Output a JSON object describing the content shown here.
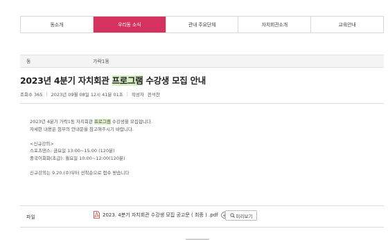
{
  "tabs": [
    {
      "label": "동소개",
      "active": false
    },
    {
      "label": "우리동 소식",
      "active": true
    },
    {
      "label": "관내 주요단체",
      "active": false
    },
    {
      "label": "자치회관소개",
      "active": false
    },
    {
      "label": "교육안내",
      "active": false
    }
  ],
  "info": {
    "label": "동",
    "value": "가락1동"
  },
  "post": {
    "title_before": "2023년 4분기 자치회관 ",
    "title_highlight": "프로그램",
    "title_after": " 수강생 모집 안내",
    "views": "조회수 365",
    "date": "2023년 09월 08일 12시 41분 01초",
    "author_label": "작성자",
    "author": "전석찬"
  },
  "content": {
    "line1_before": "2023년 4분기 가락1동 자치회관 ",
    "line1_highlight": "프로그램",
    "line1_after": " 수강생을 모집합니다.",
    "line2": "자세한 내용은 첨부의 안내문을 참고해주시기 바랍니다.",
    "line3": "<신규강의>",
    "line4": "스포츠댄스: 금요일 13:00~15:00 (120분)",
    "line5": "중국어회화(초급): 월요일 10:00~12:00(120분)",
    "line6": "신규강의는 9.20.(수)부터 선착순으로 접수 받습니다"
  },
  "file": {
    "label": "파일",
    "name": "2023. 4분기 자치회관 수강생 모집 공고문 ( 최종 ) .pdf",
    "preview_label": "미리보기"
  },
  "colors": {
    "accent": "#d6325f",
    "highlight": "#d8edc3"
  }
}
